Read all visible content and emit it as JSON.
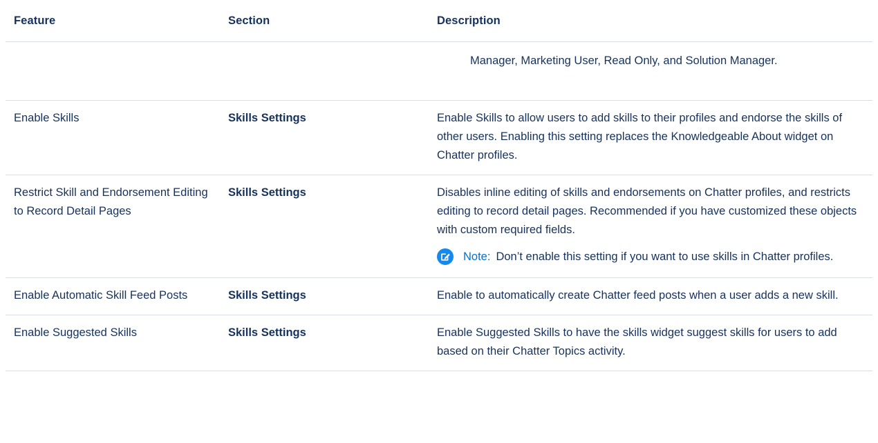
{
  "table": {
    "headers": {
      "feature": "Feature",
      "section": "Section",
      "description": "Description"
    },
    "continuation": "Manager, Marketing User, Read Only, and Solution Manager.",
    "rows": [
      {
        "feature": "Enable Skills",
        "section": "Skills Settings",
        "description": "Enable Skills to allow users to add skills to their profiles and endorse the skills of other users. Enabling this setting replaces the Knowledgeable About widget on Chatter profiles."
      },
      {
        "feature": "Restrict Skill and Endorsement Editing to Record Detail Pages",
        "section": "Skills Settings",
        "description": "Disables inline editing of skills and endorsements on Chatter profiles, and restricts editing to record detail pages. Recommended if you have customized these objects with custom required fields.",
        "note": {
          "label": "Note:",
          "text": "Don’t enable this setting if you want to use skills in Chatter profiles.",
          "icon": "note-edit-icon",
          "icon_color": "#1589ee"
        }
      },
      {
        "feature": "Enable Automatic Skill Feed Posts",
        "section": "Skills Settings",
        "description": "Enable to automatically create Chatter feed posts when a user adds a new skill."
      },
      {
        "feature": "Enable Suggested Skills",
        "section": "Skills Settings",
        "description": "Enable Suggested Skills to have the skills widget suggest skills for users to add based on their Chatter Topics activity."
      }
    ]
  },
  "colors": {
    "text": "#16325c",
    "accent": "#0070d2",
    "divider": "#d8dde6"
  }
}
